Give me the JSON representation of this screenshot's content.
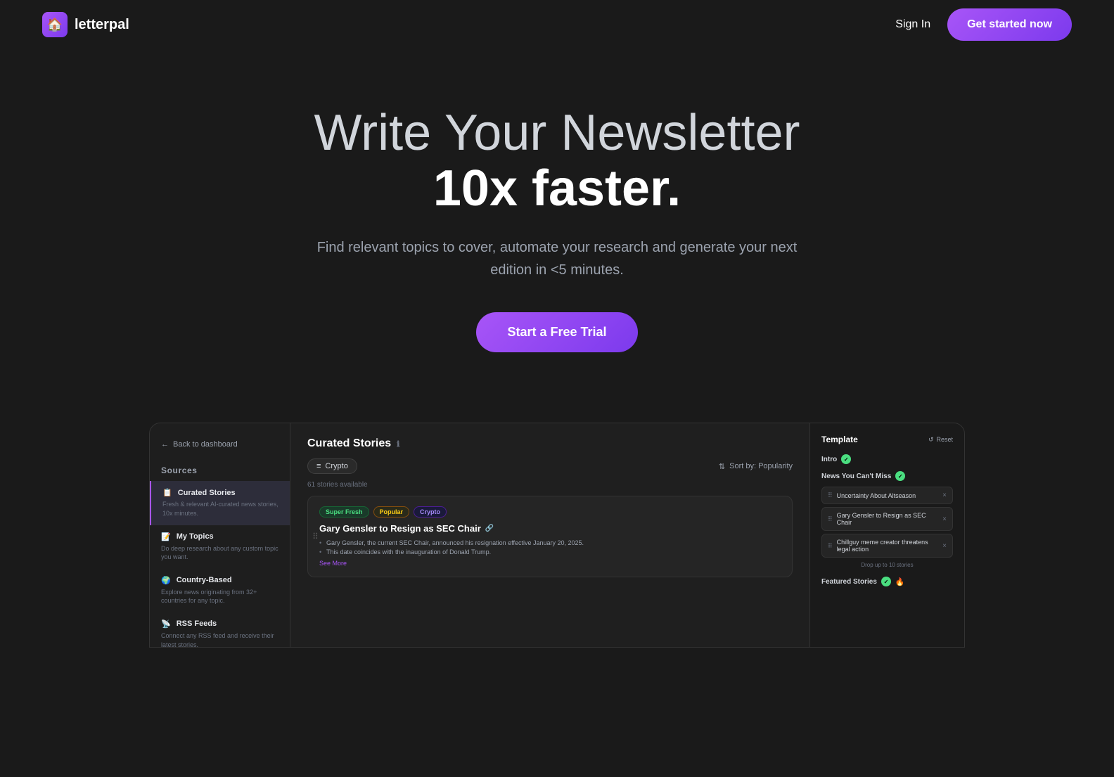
{
  "nav": {
    "logo_icon": "🏠",
    "logo_text": "letterpal",
    "sign_in_label": "Sign In",
    "get_started_label": "Get started now"
  },
  "hero": {
    "title_line1": "Write Your Newsletter",
    "title_line2": "10x faster.",
    "subtitle": "Find relevant topics to cover, automate your research and generate your next edition in <5 minutes.",
    "cta_label": "Start a Free Trial"
  },
  "dashboard": {
    "back_label": "Back to dashboard",
    "sources_header": "Sources",
    "sidebar_items": [
      {
        "id": "curated-stories",
        "icon": "📋",
        "title": "Curated Stories",
        "desc": "Fresh & relevant AI-curated news stories, 10x minutes.",
        "active": true
      },
      {
        "id": "my-topics",
        "icon": "📝",
        "title": "My Topics",
        "desc": "Do deep research about any custom topic you want.",
        "active": false
      },
      {
        "id": "country-based",
        "icon": "🌍",
        "title": "Country-Based",
        "desc": "Explore news originating from 32+ countries for any topic.",
        "active": false
      },
      {
        "id": "rss-feeds",
        "icon": "📡",
        "title": "RSS Feeds",
        "desc": "Connect any RSS feed and receive their latest stories.",
        "active": false
      }
    ],
    "main": {
      "section_title": "Curated Stories",
      "filter_tag": "Crypto",
      "sort_label": "Sort by: Popularity",
      "stories_count": "61 stories available",
      "story": {
        "tags": [
          "Super Fresh",
          "Popular",
          "Crypto"
        ],
        "title": "Gary Gensler to Resign as SEC Chair",
        "bullets": [
          "Gary Gensler, the current SEC Chair, announced his resignation effective January 20, 2025.",
          "This date coincides with the inauguration of Donald Trump."
        ],
        "see_more": "See More"
      }
    },
    "template": {
      "title": "Template",
      "reset_label": "Reset",
      "intro_label": "Intro",
      "section_label": "News You Can't Miss",
      "items": [
        "Uncertainty About Altseason",
        "Gary Gensler to Resign as SEC Chair",
        "Chillguy meme creator threatens legal action"
      ],
      "drop_hint": "Drop up to 10 stories",
      "featured_label": "Featured Stories"
    }
  }
}
